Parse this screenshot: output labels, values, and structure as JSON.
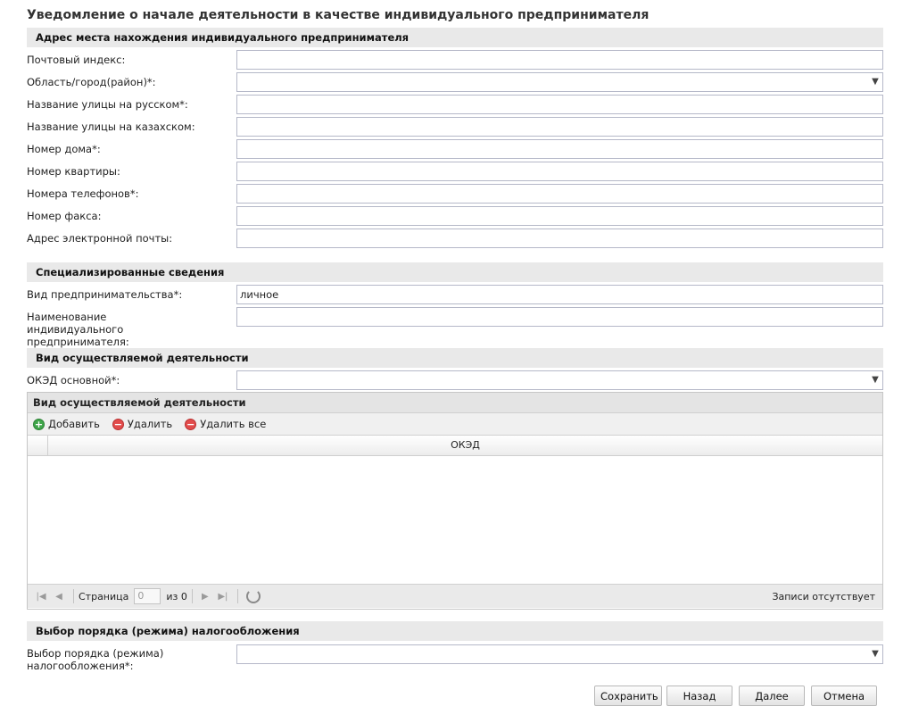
{
  "page_title": "Уведомление о начале деятельности в качестве индивидуального предпринимателя",
  "sections": {
    "address": {
      "title": "Адрес места нахождения индивидуального предпринимателя",
      "fields": {
        "postal_code": {
          "label": "Почтовый индекс:",
          "value": ""
        },
        "region": {
          "label": "Область/город(район)*:",
          "value": ""
        },
        "street_ru": {
          "label": "Название улицы на русском*:",
          "value": ""
        },
        "street_kz": {
          "label": "Название улицы на казахском:",
          "value": ""
        },
        "house": {
          "label": "Номер дома*:",
          "value": ""
        },
        "apartment": {
          "label": "Номер квартиры:",
          "value": ""
        },
        "phones": {
          "label": "Номера телефонов*:",
          "value": ""
        },
        "fax": {
          "label": "Номер факса:",
          "value": ""
        },
        "email": {
          "label": "Адрес электронной почты:",
          "value": ""
        }
      }
    },
    "special": {
      "title": "Специализированные сведения",
      "fields": {
        "business_type": {
          "label": "Вид предпринимательства*:",
          "value": "личное"
        },
        "ie_name": {
          "label": "Наименование индивидуального предпринимателя:",
          "value": ""
        }
      }
    },
    "activity": {
      "title": "Вид осуществляемой деятельности",
      "fields": {
        "oked_main": {
          "label": "ОКЭД основной*:",
          "value": ""
        }
      },
      "grid": {
        "title": "Вид осуществляемой деятельности",
        "toolbar": {
          "add": "Добавить",
          "delete": "Удалить",
          "delete_all": "Удалить все"
        },
        "columns": [
          "ОКЭД"
        ],
        "rows": [],
        "pager": {
          "page_label": "Страница",
          "page_value": "0",
          "of_label": "из 0",
          "status": "Записи отсутствует"
        }
      }
    },
    "taxation": {
      "title": "Выбор порядка (режима) налогообложения",
      "fields": {
        "tax_regime": {
          "label": "Выбор порядка (режима) налогообложения*:",
          "value": ""
        }
      }
    }
  },
  "buttons": {
    "save": "Сохранить",
    "back": "Назад",
    "next": "Далее",
    "cancel": "Отмена"
  },
  "icons": {
    "dropdown": "chevron-down-icon",
    "add": "plus-circle-icon",
    "delete": "minus-circle-icon",
    "first": "first-page-icon",
    "prev": "prev-page-icon",
    "next": "next-page-icon",
    "last": "last-page-icon",
    "refresh": "refresh-icon"
  }
}
